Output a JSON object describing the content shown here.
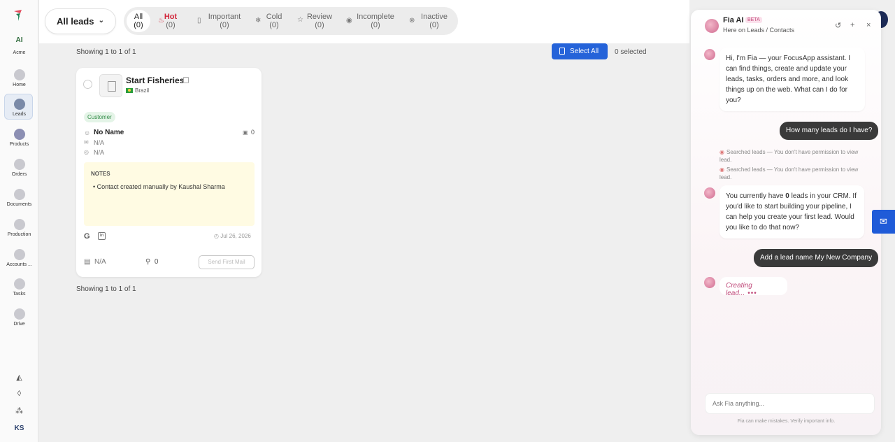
{
  "workspace": {
    "short": "AI",
    "name": "Acme"
  },
  "nav": {
    "items": [
      {
        "label": "Home"
      },
      {
        "label": "Leads"
      },
      {
        "label": "Products"
      },
      {
        "label": "Orders"
      },
      {
        "label": "Documents"
      },
      {
        "label": "Production"
      },
      {
        "label": "Accounts ..."
      },
      {
        "label": "Tasks"
      },
      {
        "label": "Drive"
      }
    ],
    "active": "Leads",
    "user_initials": "KS"
  },
  "topbar": {
    "view_label": "All leads",
    "tabs": [
      {
        "label": "All",
        "count": "(0)",
        "icon": ""
      },
      {
        "label": "Hot",
        "count": "(0)",
        "icon": "flame-icon"
      },
      {
        "label": "Important",
        "count": "(0)",
        "icon": "bookmark-icon"
      },
      {
        "label": "Cold",
        "count": "(0)",
        "icon": "snowflake-icon"
      },
      {
        "label": "Review",
        "count": "(0)",
        "icon": "star-icon"
      },
      {
        "label": "Incomplete",
        "count": "(0)",
        "icon": "circle-user-icon"
      },
      {
        "label": "Inactive",
        "count": "(0)",
        "icon": "circle-x-icon"
      }
    ]
  },
  "list": {
    "showing_top": "Showing 1 to 1 of 1",
    "showing_bottom": "Showing 1 to 1 of 1",
    "select_all_label": "Select All",
    "selected_label": "0 selected"
  },
  "lead_card": {
    "company": "Start Fisheries",
    "country": "Brazil",
    "status": "Customer",
    "contact_name": "No Name",
    "deal_count": "0",
    "email": "N/A",
    "phone": "N/A",
    "notes_header": "NOTES",
    "note": "Contact created manually by Kaushal Sharma",
    "date": "Jul 26, 2026",
    "doc": "N/A",
    "attachments": "0",
    "send_button": "Send First Mail"
  },
  "assistant": {
    "title": "Fia AI",
    "badge": "BETA",
    "context": "Here on Leads / Contacts",
    "messages": {
      "intro": "Hi, I'm Fia — your FocusApp assistant. I can find things, create and update your leads, tasks, orders and more, and look things up on the web. What can I do for you?",
      "user1": "How many leads do I have?",
      "tool1": "Searched leads — You don't have permission to view lead.",
      "tool2": "Searched leads — You don't have permission to view lead.",
      "reply_pre": "You currently have ",
      "reply_bold": "0",
      "reply_post": " leads in your CRM. If you'd like to start building your pipeline, I can help you create your first lead. Would you like to do that now?",
      "user2": "Add a lead name My New Company",
      "creating": "Creating lead..."
    },
    "input_placeholder": "Ask Fia anything...",
    "disclaimer": "Fia can make mistakes. Verify important info."
  },
  "colors": {
    "accent": "#2563d9",
    "hot": "#d2263b",
    "assistant": "#c04a7a"
  }
}
